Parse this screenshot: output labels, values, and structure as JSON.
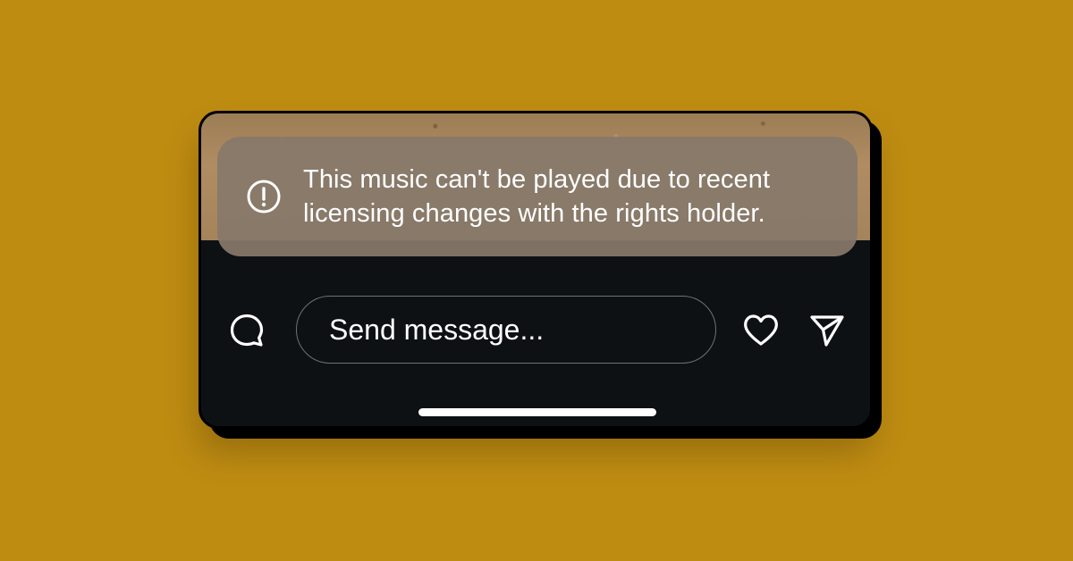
{
  "colors": {
    "background": "#bf8c12",
    "card": "#0e1114",
    "toast": "#86786a",
    "text": "#ffffff"
  },
  "toast": {
    "icon": "alert-circle-icon",
    "message": "This music can't be played due to recent licensing changes with the rights holder."
  },
  "composer": {
    "comment_icon": "comment-bubble-icon",
    "placeholder": "Send message...",
    "like_icon": "heart-icon",
    "send_icon": "send-icon"
  }
}
